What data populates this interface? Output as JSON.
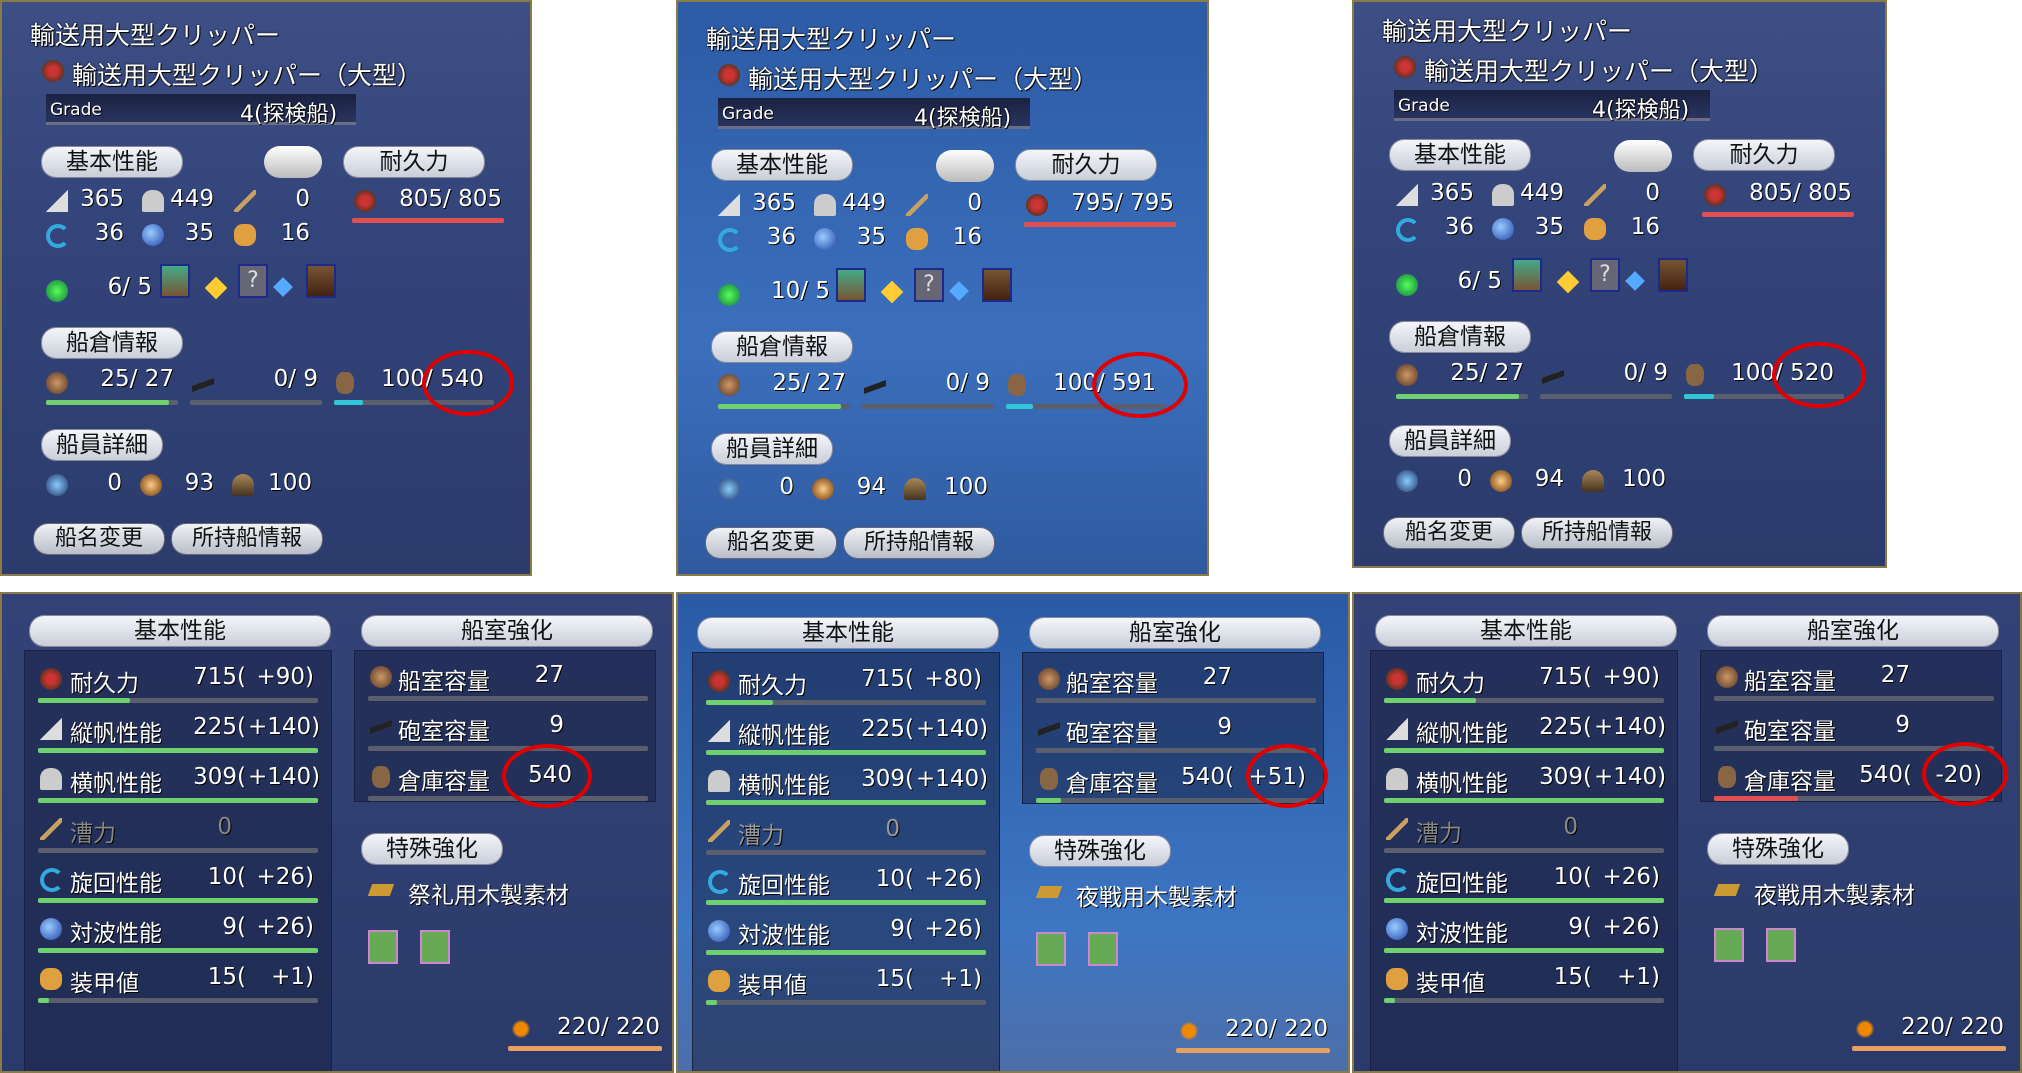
{
  "top_panels": [
    {
      "title": "輸送用大型クリッパー",
      "subtitle": "輸送用大型クリッパー（大型）",
      "grade_label": "Grade",
      "grade_value": "4(探検船)",
      "section_basic": "基本性能",
      "section_durability": "耐久力",
      "vertical_sail": "365",
      "horizontal_sail": "449",
      "rowing": "0",
      "durability": "805/ 805",
      "turning": "36",
      "wave_resistance": "35",
      "armor": "16",
      "sailors_slot": "6/ 5",
      "section_hold": "船倉情報",
      "cabin": "25/ 27",
      "cannon": "0/ 9",
      "cargo_used": "100",
      "cargo_capacity": "540",
      "cargo_display": "100/ 540",
      "section_crew": "船員詳細",
      "crew_a": "0",
      "crew_b": "93",
      "crew_c": "100",
      "btn_rename": "船名変更",
      "btn_owned": "所持船情報"
    },
    {
      "title": "輸送用大型クリッパー",
      "subtitle": "輸送用大型クリッパー（大型）",
      "grade_label": "Grade",
      "grade_value": "4(探検船)",
      "section_basic": "基本性能",
      "section_durability": "耐久力",
      "vertical_sail": "365",
      "horizontal_sail": "449",
      "rowing": "0",
      "durability": "795/ 795",
      "turning": "36",
      "wave_resistance": "35",
      "armor": "16",
      "sailors_slot": "10/ 5",
      "section_hold": "船倉情報",
      "cabin": "25/ 27",
      "cannon": "0/ 9",
      "cargo_used": "100",
      "cargo_capacity": "591",
      "cargo_display": "100/ 591",
      "section_crew": "船員詳細",
      "crew_a": "0",
      "crew_b": "94",
      "crew_c": "100",
      "btn_rename": "船名変更",
      "btn_owned": "所持船情報"
    },
    {
      "title": "輸送用大型クリッパー",
      "subtitle": "輸送用大型クリッパー（大型）",
      "grade_label": "Grade",
      "grade_value": "4(探検船)",
      "section_basic": "基本性能",
      "section_durability": "耐久力",
      "vertical_sail": "365",
      "horizontal_sail": "449",
      "rowing": "0",
      "durability": "805/ 805",
      "turning": "36",
      "wave_resistance": "35",
      "armor": "16",
      "sailors_slot": "6/ 5",
      "section_hold": "船倉情報",
      "cabin": "25/ 27",
      "cannon": "0/ 9",
      "cargo_used": "100",
      "cargo_capacity": "520",
      "cargo_display": "100/ 520",
      "section_crew": "船員詳細",
      "crew_a": "0",
      "crew_b": "94",
      "crew_c": "100",
      "btn_rename": "船名変更",
      "btn_owned": "所持船情報"
    }
  ],
  "bottom_panels": [
    {
      "section_basic": "基本性能",
      "section_cabin": "船室強化",
      "stats": [
        {
          "label": "耐久力",
          "value": "715(",
          "bonus": "+90)"
        },
        {
          "label": "縦帆性能",
          "value": "225(",
          "bonus": "+140)"
        },
        {
          "label": "横帆性能",
          "value": "309(",
          "bonus": "+140)"
        },
        {
          "label": "漕力",
          "value": "0",
          "bonus": ""
        },
        {
          "label": "旋回性能",
          "value": "10(",
          "bonus": "+26)"
        },
        {
          "label": "対波性能",
          "value": "9(",
          "bonus": "+26)"
        },
        {
          "label": "装甲値",
          "value": "15(",
          "bonus": "+1)"
        }
      ],
      "cabin_stats": [
        {
          "label": "船室容量",
          "value": "27"
        },
        {
          "label": "砲室容量",
          "value": "9"
        },
        {
          "label": "倉庫容量",
          "value": "540"
        }
      ],
      "section_special": "特殊強化",
      "special_material": "祭礼用木製素材",
      "endurance": "220/ 220"
    },
    {
      "section_basic": "基本性能",
      "section_cabin": "船室強化",
      "stats": [
        {
          "label": "耐久力",
          "value": "715(",
          "bonus": "+80)"
        },
        {
          "label": "縦帆性能",
          "value": "225(",
          "bonus": "+140)"
        },
        {
          "label": "横帆性能",
          "value": "309(",
          "bonus": "+140)"
        },
        {
          "label": "漕力",
          "value": "0",
          "bonus": ""
        },
        {
          "label": "旋回性能",
          "value": "10(",
          "bonus": "+26)"
        },
        {
          "label": "対波性能",
          "value": "9(",
          "bonus": "+26)"
        },
        {
          "label": "装甲値",
          "value": "15(",
          "bonus": "+1)"
        }
      ],
      "cabin_stats": [
        {
          "label": "船室容量",
          "value": "27"
        },
        {
          "label": "砲室容量",
          "value": "9"
        },
        {
          "label": "倉庫容量",
          "value": "540(",
          "bonus": "+51)"
        }
      ],
      "section_special": "特殊強化",
      "special_material": "夜戦用木製素材",
      "endurance": "220/ 220"
    },
    {
      "section_basic": "基本性能",
      "section_cabin": "船室強化",
      "stats": [
        {
          "label": "耐久力",
          "value": "715(",
          "bonus": "+90)"
        },
        {
          "label": "縦帆性能",
          "value": "225(",
          "bonus": "+140)"
        },
        {
          "label": "横帆性能",
          "value": "309(",
          "bonus": "+140)"
        },
        {
          "label": "漕力",
          "value": "0",
          "bonus": ""
        },
        {
          "label": "旋回性能",
          "value": "10(",
          "bonus": "+26)"
        },
        {
          "label": "対波性能",
          "value": "9(",
          "bonus": "+26)"
        },
        {
          "label": "装甲値",
          "value": "15(",
          "bonus": "+1)"
        }
      ],
      "cabin_stats": [
        {
          "label": "船室容量",
          "value": "27"
        },
        {
          "label": "砲室容量",
          "value": "9"
        },
        {
          "label": "倉庫容量",
          "value": "540(",
          "bonus": "-20)"
        }
      ],
      "section_special": "特殊強化",
      "special_material": "夜戦用木製素材",
      "endurance": "220/ 220"
    }
  ],
  "colors": {
    "highlight_ring": "#e00000",
    "green_bar": "#6fd06f",
    "red_bar": "#e05050",
    "cyan_bar": "#30c8d8"
  }
}
